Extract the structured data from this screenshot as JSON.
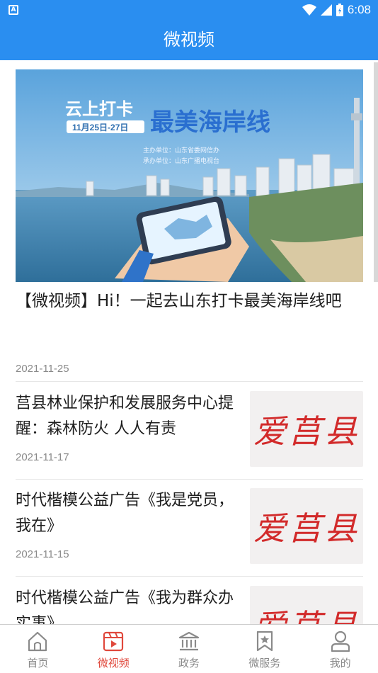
{
  "status_bar": {
    "time": "6:08",
    "left_badge": "A"
  },
  "header": {
    "title": "微视频"
  },
  "featured": {
    "image": {
      "headline_left": "云上打卡",
      "headline_right": "最美海岸线",
      "date_range": "11月25日-27日",
      "organizer": "主办单位：山东省委网信办",
      "co_organizer": "承办单位：山东广播电视台"
    },
    "title": "【微视频】Hi！一起去山东打卡最美海岸线吧",
    "date": "2021-11-25"
  },
  "items": [
    {
      "title": "莒县林业保护和发展服务中心提醒：森林防火 人人有责",
      "date": "2021-11-17",
      "thumb_text": "爱莒县"
    },
    {
      "title": "时代楷模公益广告《我是党员，我在》",
      "date": "2021-11-15",
      "thumb_text": "爱莒县"
    },
    {
      "title": "时代楷模公益广告《我为群众办实事》",
      "date": "",
      "thumb_text": "爱莒县"
    }
  ],
  "tabs": [
    {
      "label": "首页",
      "icon": "home-icon",
      "active": false
    },
    {
      "label": "微视频",
      "icon": "video-icon",
      "active": true
    },
    {
      "label": "政务",
      "icon": "government-building-icon",
      "active": false
    },
    {
      "label": "微服务",
      "icon": "bookmark-star-icon",
      "active": false
    },
    {
      "label": "我的",
      "icon": "user-icon",
      "active": false
    }
  ],
  "colors": {
    "brand": "#2a8ef0",
    "active_tab": "#e0483c",
    "date": "#8a8a8a"
  }
}
